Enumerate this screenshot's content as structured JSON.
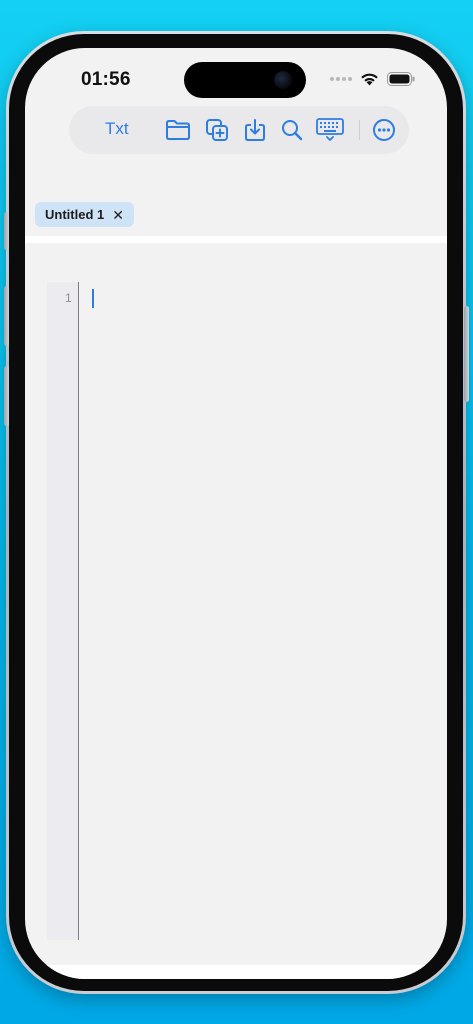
{
  "status_bar": {
    "time": "01:56"
  },
  "toolbar": {
    "txt_label": "Txt",
    "icons": [
      "folder-icon",
      "duplicate-icon",
      "download-icon",
      "search-icon",
      "keyboard-icon",
      "more-icon"
    ],
    "accent_color": "#2f7de1"
  },
  "tabs": [
    {
      "label": "Untitled 1",
      "close": "✕"
    }
  ],
  "editor": {
    "line_numbers": [
      "1"
    ]
  },
  "colors": {
    "background": "#00b6ea",
    "screen": "#f2f2f2",
    "tab_bg": "#cfe3f6"
  }
}
